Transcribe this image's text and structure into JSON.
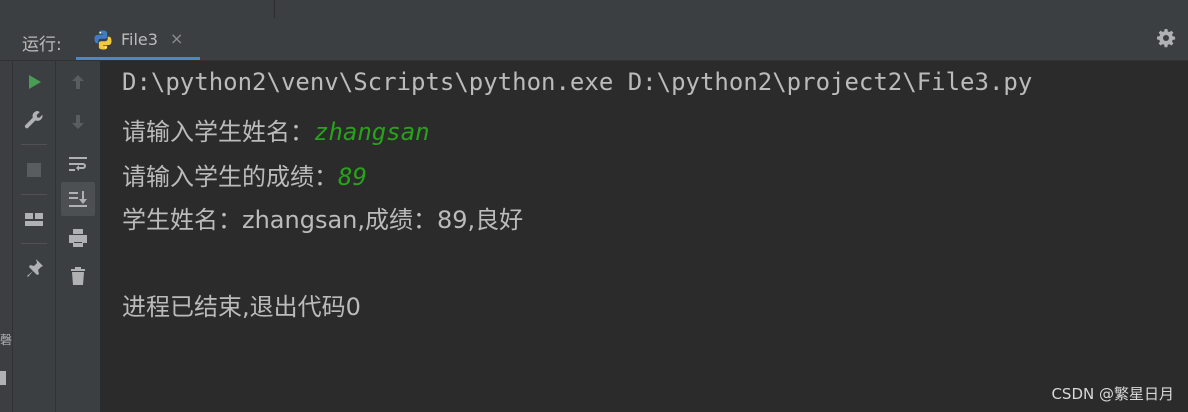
{
  "run_bar": {
    "label": "运行:",
    "tab": {
      "name": "File3",
      "close": "×"
    }
  },
  "toolbar_left": [
    {
      "icon": "run-icon"
    },
    {
      "icon": "wrench-icon"
    },
    {
      "icon": "stop-icon"
    },
    {
      "icon": "layout-icon"
    },
    {
      "icon": "pin-icon"
    }
  ],
  "toolbar_right": [
    {
      "icon": "arrow-up-icon"
    },
    {
      "icon": "arrow-down-icon"
    },
    {
      "icon": "soft-wrap-icon"
    },
    {
      "icon": "scroll-to-end-icon"
    },
    {
      "icon": "print-icon"
    },
    {
      "icon": "trash-icon"
    }
  ],
  "console": {
    "command": "D:\\python2\\venv\\Scripts\\python.exe D:\\python2\\project2\\File3.py",
    "prompt_name": "请输入学生姓名：",
    "input_name": "zhangsan",
    "prompt_score": "请输入学生的成绩：",
    "input_score": "89",
    "result": "学生姓名：zhangsan,成绩：89,良好",
    "exit": "进程已结束,退出代码0"
  },
  "left_edge_char": "磬",
  "watermark": "CSDN @繁星日月",
  "colors": {
    "background": "#2b2b2b",
    "panel": "#3c3f41",
    "text": "#bbbbbb",
    "input": "#27a31a",
    "tab_underline": "#4a88c7",
    "run_green": "#499c54"
  }
}
